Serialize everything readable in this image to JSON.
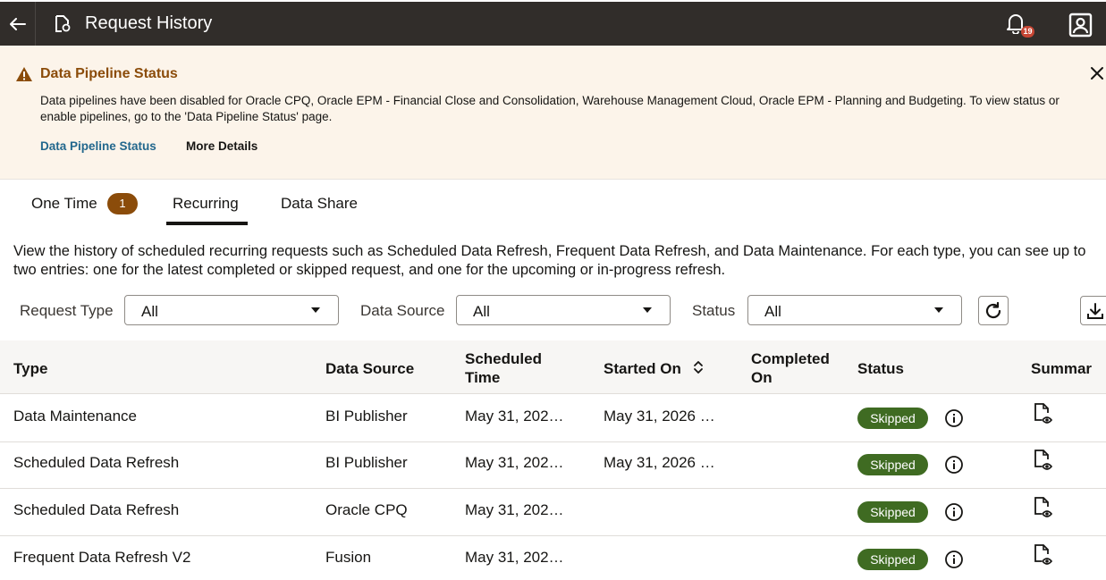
{
  "header": {
    "title": "Request History",
    "notification_count": "19"
  },
  "banner": {
    "title": "Data Pipeline Status",
    "message": "Data pipelines have been disabled for Oracle CPQ, Oracle EPM - Financial Close and Consolidation, Warehouse Management Cloud, Oracle EPM - Planning and Budgeting. To view status or enable pipelines, go to the 'Data Pipeline Status' page.",
    "link_status": "Data Pipeline Status",
    "link_details": "More Details"
  },
  "tabs": [
    {
      "label": "One Time",
      "badge": "1"
    },
    {
      "label": "Recurring",
      "active": true
    },
    {
      "label": "Data Share"
    }
  ],
  "description": "View the history of scheduled recurring requests such as Scheduled Data Refresh, Frequent Data Refresh, and Data Maintenance. For each type, you can see up to two entries: one for the latest completed or skipped request, and one for the upcoming or in-progress refresh.",
  "filters": {
    "request_type": {
      "label": "Request Type",
      "value": "All"
    },
    "data_source": {
      "label": "Data Source",
      "value": "All"
    },
    "status": {
      "label": "Status",
      "value": "All"
    }
  },
  "table": {
    "columns": {
      "type": "Type",
      "data_source": "Data Source",
      "scheduled_time_1": "Scheduled",
      "scheduled_time_2": "Time",
      "started_on": "Started On",
      "completed_on_1": "Completed",
      "completed_on_2": "On",
      "status": "Status",
      "summary": "Summar"
    },
    "rows": [
      {
        "type": "Data Maintenance",
        "data_source": "BI Publisher",
        "scheduled": "May 31, 202…",
        "started": "May 31, 2026 …",
        "completed": "",
        "status": "Skipped"
      },
      {
        "type": "Scheduled Data Refresh",
        "data_source": "BI Publisher",
        "scheduled": "May 31, 202…",
        "started": "May 31, 2026 …",
        "completed": "",
        "status": "Skipped"
      },
      {
        "type": "Scheduled Data Refresh",
        "data_source": "Oracle CPQ",
        "scheduled": "May 31, 202…",
        "started": "",
        "completed": "",
        "status": "Skipped"
      },
      {
        "type": "Frequent Data Refresh V2",
        "data_source": "Fusion",
        "scheduled": "May 31, 202…",
        "started": "",
        "completed": "",
        "status": "Skipped"
      }
    ]
  },
  "colors": {
    "header_bg": "#312d2a",
    "banner_bg": "#fcf4ea",
    "warning": "#8b4c0a",
    "link": "#22678d",
    "status_skipped": "#3f6b22",
    "badge_red": "#c74634"
  }
}
